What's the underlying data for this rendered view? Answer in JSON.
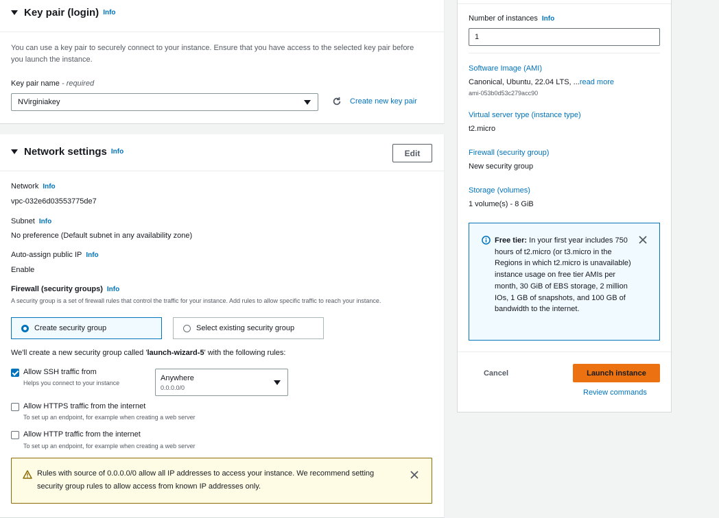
{
  "key_pair": {
    "title": "Key pair (login)",
    "info": "Info",
    "description": "You can use a key pair to securely connect to your instance. Ensure that you have access to the selected key pair before you launch the instance.",
    "name_label": "Key pair name",
    "name_required": "- required",
    "selected": "NVirginiakey",
    "create_link": "Create new key pair"
  },
  "network": {
    "title": "Network settings",
    "info": "Info",
    "edit_label": "Edit",
    "network_label": "Network",
    "network_value": "vpc-032e6d03553775de7",
    "subnet_label": "Subnet",
    "subnet_value": "No preference (Default subnet in any availability zone)",
    "public_ip_label": "Auto-assign public IP",
    "public_ip_value": "Enable",
    "firewall_label": "Firewall (security groups)",
    "firewall_desc": "A security group is a set of firewall rules that control the traffic for your instance. Add rules to allow specific traffic to reach your instance.",
    "create_sg": "Create security group",
    "select_sg": "Select existing security group",
    "rules_text_pre": "We'll create a new security group called '",
    "rules_text_name": "launch-wizard-5",
    "rules_text_post": "' with the following rules:",
    "ssh_label": "Allow SSH traffic from",
    "ssh_sub": "Helps you connect to your instance",
    "ssh_source": "Anywhere",
    "ssh_cidr": "0.0.0.0/0",
    "https_label": "Allow HTTPS traffic from the internet",
    "https_sub": "To set up an endpoint, for example when creating a web server",
    "http_label": "Allow HTTP traffic from the internet",
    "http_sub": "To set up an endpoint, for example when creating a web server",
    "warning": "Rules with source of 0.0.0.0/0 allow all IP addresses to access your instance. We recommend setting security group rules to allow access from known IP addresses only."
  },
  "summary": {
    "instances_label": "Number of instances",
    "info": "Info",
    "instances_value": "1",
    "ami_label": "Software Image (AMI)",
    "ami_value": "Canonical, Ubuntu, 22.04 LTS, ...",
    "ami_more": "read more",
    "ami_id": "ami-053b0d53c279acc90",
    "type_label": "Virtual server type (instance type)",
    "type_value": "t2.micro",
    "firewall_label": "Firewall (security group)",
    "firewall_value": "New security group",
    "storage_label": "Storage (volumes)",
    "storage_value": "1 volume(s) - 8 GiB",
    "free_tier_title": "Free tier:",
    "free_tier_text": "In your first year includes 750 hours of t2.micro (or t3.micro in the Regions in which t2.micro is unavailable) instance usage on free tier AMIs per month, 30 GiB of EBS storage, 2 million IOs, 1 GB of snapshots, and 100 GB of bandwidth to the internet.",
    "cancel_label": "Cancel",
    "launch_label": "Launch instance",
    "review_label": "Review commands"
  },
  "colors": {
    "link": "#0073bb",
    "primary_button": "#ec7211",
    "warning_border": "#8a6b05",
    "info_border": "#0073bb"
  }
}
